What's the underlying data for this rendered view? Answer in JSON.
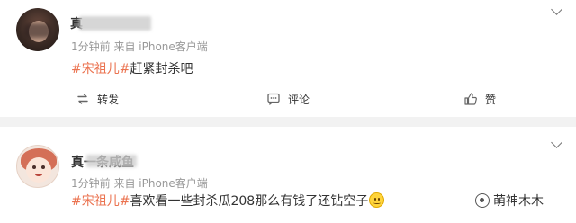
{
  "comments": [
    {
      "username": "真",
      "meta": "1分钟前 来自 iPhone客户端",
      "topic": "#宋祖儿#",
      "text": "赶紧封杀吧"
    },
    {
      "username": "真一条咸鱼",
      "meta": "1分钟前 来自 iPhone客户端",
      "topic": "#宋祖儿#",
      "text": "喜欢看一些封杀瓜208那么有钱了还钻空子"
    }
  ],
  "actions": {
    "repost_label": "转发",
    "comment_label": "评论",
    "like_label": "赞"
  },
  "watermark": "萌神木木",
  "icons": {
    "repost": "repost-icon",
    "comment": "comment-icon",
    "like": "thumbs-up-icon",
    "more": "chevron-down-icon",
    "emoji": "smile-emoji-icon"
  },
  "colors": {
    "topic": "#eb7350",
    "text": "#333333",
    "meta": "#999999",
    "background": "#f2f2f2"
  }
}
